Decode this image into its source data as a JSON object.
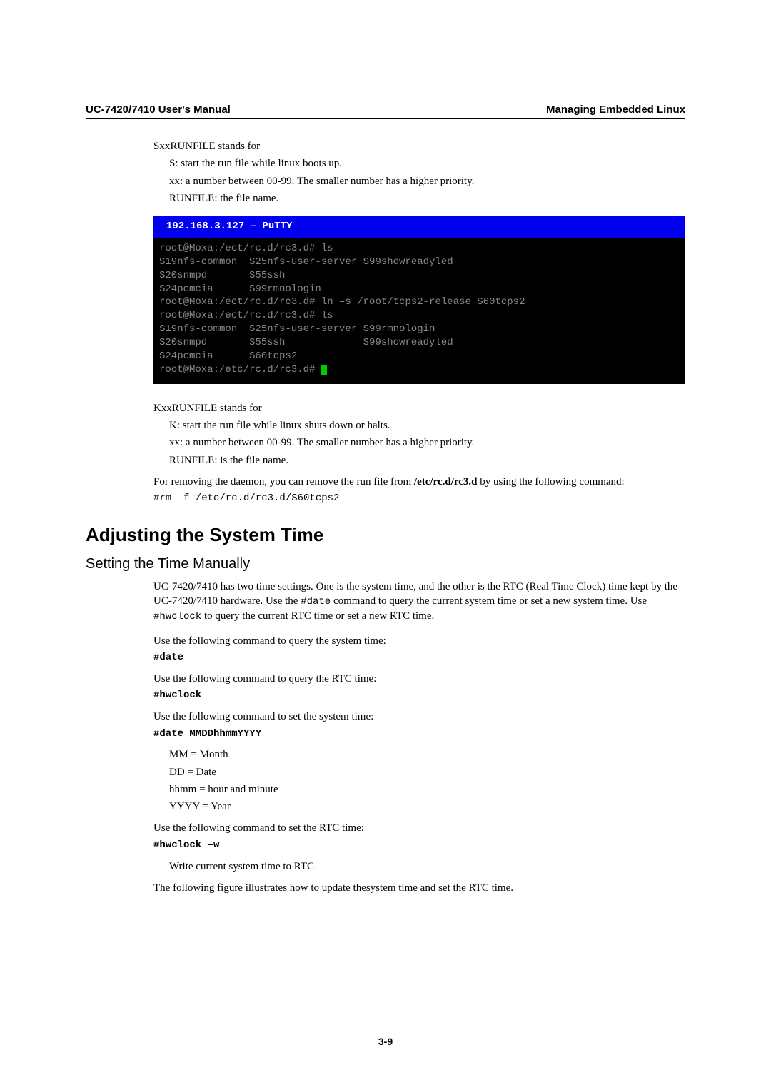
{
  "header": {
    "left": "UC-7420/7410 User's Manual",
    "right": "Managing Embedded Linux"
  },
  "sxx": {
    "title": "SxxRUNFILE stands for",
    "l1": "S: start the run file while linux boots up.",
    "l2": "xx: a number between 00-99. The smaller number has a higher priority.",
    "l3": "RUNFILE: the file name."
  },
  "terminal": {
    "title": "  192.168.3.127 – PuTTY",
    "body": "root@Moxa:/ect/rc.d/rc3.d# ls\nS19nfs-common  S25nfs-user-server S99showreadyled\nS20snmpd       S55ssh\nS24pcmcia      S99rmnologin\nroot@Moxa:/ect/rc.d/rc3.d# ln –s /root/tcps2-release S60tcps2\nroot@Moxa:/ect/rc.d/rc3.d# ls\nS19nfs-common  S25nfs-user-server S99rmnologin\nS20snmpd       S55ssh             S99showreadyled\nS24pcmcia      S60tcps2\nroot@Moxa:/etc/rc.d/rc3.d#"
  },
  "kxx": {
    "title": "KxxRUNFILE stands for",
    "l1": "K: start the run file while linux shuts down or halts.",
    "l2": "xx: a number between 00-99. The smaller number has a higher priority.",
    "l3": "RUNFILE: is the file name."
  },
  "remove": {
    "p1a": "For removing the daemon, you can remove the run file from ",
    "p1b": "/etc/rc.d/rc3.d",
    "p1c": " by using the following command:",
    "cmd": "#rm –f /etc/rc.d/rc3.d/S60tcps2"
  },
  "h1": "Adjusting the System Time",
  "h2": "Setting the Time Manually",
  "time": {
    "p1a": "UC-7420/7410 has two time settings. One is the system time, and the other is the RTC (Real Time Clock) time kept by the UC-7420/7410 hardware. Use the ",
    "p1b": "#date",
    "p1c": " command to query the current system time or set a new system time. Use ",
    "p1d": "#hwclock",
    "p1e": " to query the current RTC time or set a new RTC time.",
    "q1": "Use the following command to query the system time:",
    "q1cmd": "#date",
    "q2": "Use the following command to query the RTC time:",
    "q2cmd": "#hwclock",
    "q3": "Use the following command to set the system time:",
    "q3cmd": "#date MMDDhhmmYYYY",
    "mm": "MM = Month",
    "dd": "DD = Date",
    "hh": "hhmm = hour and minute",
    "yy": "YYYY = Year",
    "q4": "Use the following command to set the RTC time:",
    "q4cmd": "#hwclock –w",
    "write": "Write current system time to RTC",
    "fig": "The following figure illustrates how to update thesystem time and set the RTC time."
  },
  "page_num": "3-9"
}
